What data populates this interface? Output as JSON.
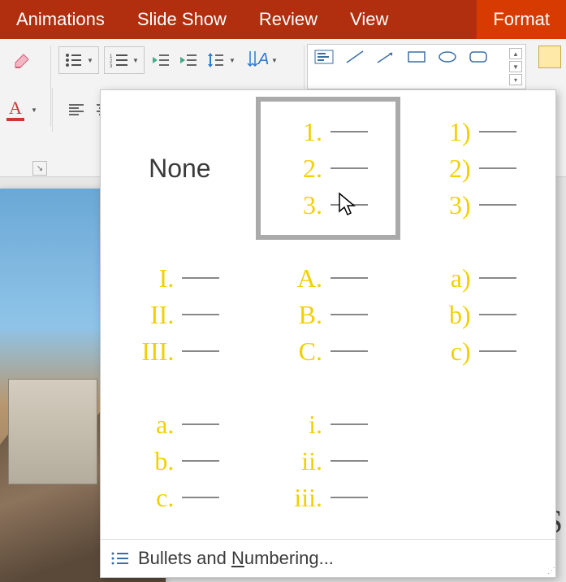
{
  "menubar": {
    "items": [
      {
        "label": "Animations"
      },
      {
        "label": "Slide Show"
      },
      {
        "label": "Review"
      },
      {
        "label": "View"
      },
      {
        "label": "Format",
        "active": true
      }
    ]
  },
  "ribbon": {
    "bullets_tooltip": "Bullets",
    "numbering_tooltip": "Numbering",
    "font_color_letter": "A"
  },
  "numbering_popup": {
    "none_label": "None",
    "options": [
      {
        "id": "none",
        "labels": []
      },
      {
        "id": "period",
        "labels": [
          "1.",
          "2.",
          "3."
        ],
        "selected": true
      },
      {
        "id": "paren",
        "labels": [
          "1)",
          "2)",
          "3)"
        ]
      },
      {
        "id": "upper-roman",
        "labels": [
          "I.",
          "II.",
          "III."
        ]
      },
      {
        "id": "upper-alpha",
        "labels": [
          "A.",
          "B.",
          "C."
        ]
      },
      {
        "id": "lower-alpha-paren",
        "labels": [
          "a)",
          "b)",
          "c)"
        ]
      },
      {
        "id": "lower-alpha",
        "labels": [
          "a.",
          "b.",
          "c."
        ]
      },
      {
        "id": "lower-roman",
        "labels": [
          "i.",
          "ii.",
          "iii."
        ]
      }
    ],
    "footer_prefix": "Bullets and ",
    "footer_key": "N",
    "footer_suffix": "umbering..."
  }
}
